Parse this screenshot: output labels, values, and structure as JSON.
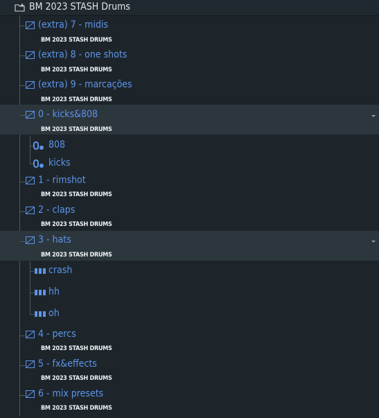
{
  "browser": {
    "root": {
      "label": "BM 2023 STASH Drums",
      "icon": "folder-add-icon"
    },
    "accent_color": "#5d94e8",
    "sub_text": "BM 2023 STASH DRUMS",
    "folders": [
      {
        "label": "(extra) 7 - midis",
        "sub": "BM 2023 STASH DRUMS"
      },
      {
        "label": "(extra) 8 - one shots",
        "sub": "BM 2023 STASH DRUMS"
      },
      {
        "label": "(extra) 9 - marcações",
        "sub": "BM 2023 STASH DRUMS"
      },
      {
        "label": "0 - kicks&808",
        "sub": "BM 2023 STASH DRUMS",
        "children": [
          {
            "label": "808",
            "icon": "plugin-icon"
          },
          {
            "label": "kicks",
            "icon": "plugin-icon"
          }
        ]
      },
      {
        "label": "1 - rimshot",
        "sub": "BM 2023 STASH DRUMS"
      },
      {
        "label": "2 - claps",
        "sub": "BM 2023 STASH DRUMS"
      },
      {
        "label": "3 - hats",
        "sub": "BM 2023 STASH DRUMS",
        "children": [
          {
            "label": "crash",
            "icon": "pattern-icon"
          },
          {
            "label": "hh",
            "icon": "pattern-icon"
          },
          {
            "label": "oh",
            "icon": "pattern-icon"
          }
        ]
      },
      {
        "label": "4 - percs",
        "sub": "BM 2023 STASH DRUMS"
      },
      {
        "label": "5 - fx&effects",
        "sub": "BM 2023 STASH DRUMS"
      },
      {
        "label": "6 - mix presets",
        "sub": "BM 2023 STASH DRUMS"
      }
    ]
  }
}
